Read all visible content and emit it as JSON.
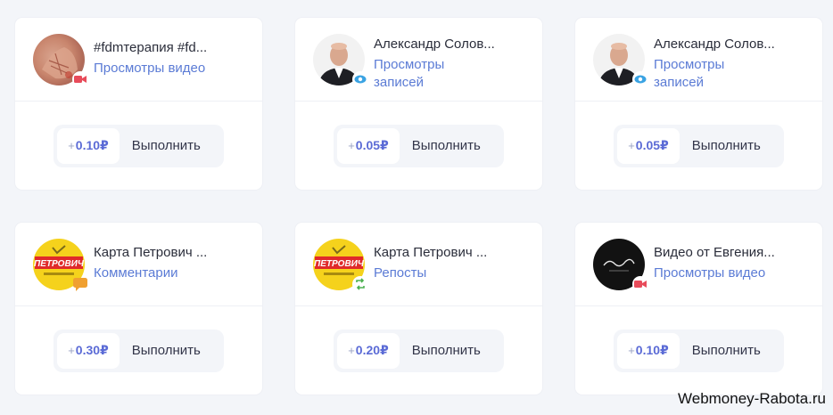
{
  "tasks": [
    {
      "title": "#fdmтерапия #fd...",
      "type": "Просмотры видео",
      "price_prefix": "+",
      "price": "0.10₽",
      "button": "Выполнить",
      "avatar": "hand",
      "badge": "video-camera-icon",
      "badge_color": "#e84b5a"
    },
    {
      "title": "Александр Солов...",
      "type": "Просмотры записей",
      "price_prefix": "+",
      "price": "0.05₽",
      "button": "Выполнить",
      "avatar": "man",
      "badge": "eye-icon",
      "badge_color": "#3aa3e3"
    },
    {
      "title": "Александр Солов...",
      "type": "Просмотры записей",
      "price_prefix": "+",
      "price": "0.05₽",
      "button": "Выполнить",
      "avatar": "man",
      "badge": "eye-icon",
      "badge_color": "#3aa3e3"
    },
    {
      "title": "Карта Петрович ...",
      "type": "Комментарии",
      "price_prefix": "+",
      "price": "0.30₽",
      "button": "Выполнить",
      "avatar": "petrovich",
      "badge": "comment-icon",
      "badge_color": "#f0a030"
    },
    {
      "title": "Карта Петрович ...",
      "type": "Репосты",
      "price_prefix": "+",
      "price": "0.20₽",
      "button": "Выполнить",
      "avatar": "petrovich",
      "badge": "repost-icon",
      "badge_color": "#4cb050"
    },
    {
      "title": "Видео от Евгения...",
      "type": "Просмотры видео",
      "price_prefix": "+",
      "price": "0.10₽",
      "button": "Выполнить",
      "avatar": "logo-dark",
      "badge": "video-camera-icon",
      "badge_color": "#e84b5a"
    }
  ],
  "brand_text": "ПЕТРОВИЧ",
  "watermark": "Webmoney-Rabota.ru"
}
